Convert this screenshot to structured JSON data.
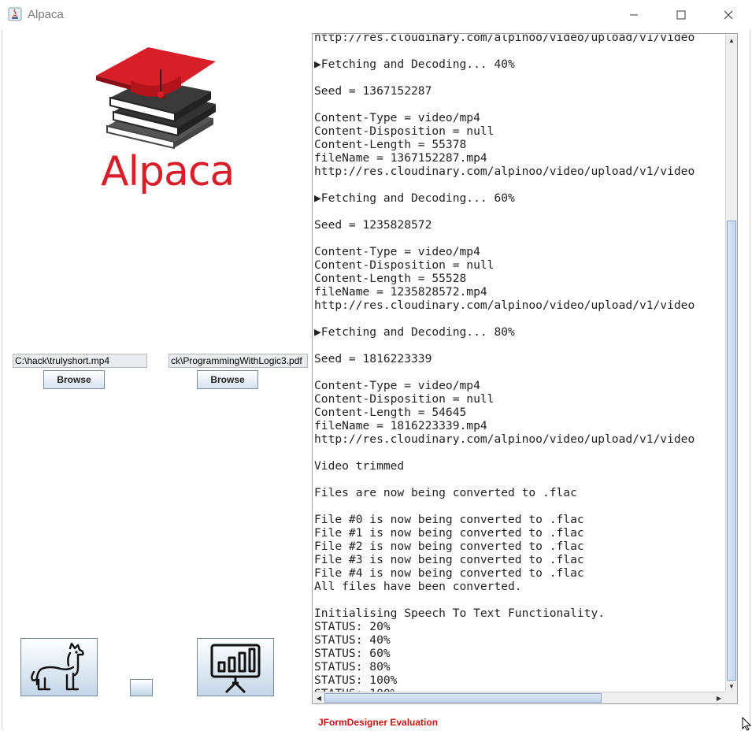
{
  "window": {
    "title": "Alpaca",
    "controls": [
      "minimize",
      "maximize",
      "close"
    ]
  },
  "logo": {
    "text": "Alpaca",
    "icon": "graduation-cap-books-logo",
    "color": "#d81e28"
  },
  "inputs": {
    "video_path": "C:\\hack\\trulyshort.mp4",
    "pdf_path": "ck\\ProgrammingWithLogic3.pdf"
  },
  "buttons": {
    "browse_video": "Browse",
    "browse_pdf": "Browse",
    "llama_icon": "llama-icon",
    "presentation_icon": "presentation-chart-icon"
  },
  "log": {
    "text": "http://res.cloudinary.com/alpinoo/video/upload/v1/video\n\n▶Fetching and Decoding... 40%\n\nSeed = 1367152287\n\nContent-Type = video/mp4\nContent-Disposition = null\nContent-Length = 55378\nfileName = 1367152287.mp4\nhttp://res.cloudinary.com/alpinoo/video/upload/v1/video\n\n▶Fetching and Decoding... 60%\n\nSeed = 1235828572\n\nContent-Type = video/mp4\nContent-Disposition = null\nContent-Length = 55528\nfileName = 1235828572.mp4\nhttp://res.cloudinary.com/alpinoo/video/upload/v1/video\n\n▶Fetching and Decoding... 80%\n\nSeed = 1816223339\n\nContent-Type = video/mp4\nContent-Disposition = null\nContent-Length = 54645\nfileName = 1816223339.mp4\nhttp://res.cloudinary.com/alpinoo/video/upload/v1/video\n\nVideo trimmed\n\nFiles are now being converted to .flac\n\nFile #0 is now being converted to .flac\nFile #1 is now being converted to .flac\nFile #2 is now being converted to .flac\nFile #3 is now being converted to .flac\nFile #4 is now being converted to .flac\nAll files have been converted.\n\nInitialising Speech To Text Functionality.\nSTATUS: 20%\nSTATUS: 40%\nSTATUS: 60%\nSTATUS: 80%\nSTATUS: 100%\nSTATUS: 100%"
  },
  "footer": {
    "evaluation_label": "JFormDesigner Evaluation",
    "color": "#d01010"
  }
}
